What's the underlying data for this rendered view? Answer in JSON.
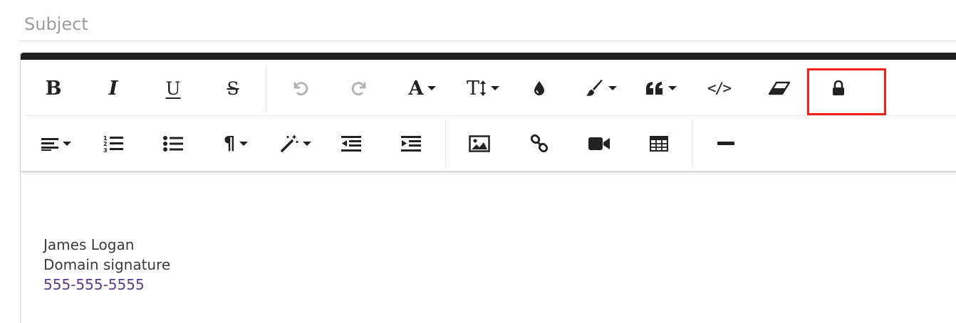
{
  "subject": {
    "placeholder": "Subject",
    "value": ""
  },
  "toolbar": {
    "row1": [
      {
        "name": "bold",
        "glyph": "B"
      },
      {
        "name": "italic",
        "glyph": "I"
      },
      {
        "name": "underline",
        "glyph": "U"
      },
      {
        "name": "strikethrough",
        "glyph": "S"
      },
      {
        "name": "undo",
        "icon": "undo-icon",
        "state": "disabled"
      },
      {
        "name": "redo",
        "icon": "redo-icon",
        "state": "disabled"
      },
      {
        "name": "font-color",
        "glyph": "A",
        "dropdown": true
      },
      {
        "name": "font-size",
        "glyph": "T",
        "dropdown": true
      },
      {
        "name": "fill-color",
        "icon": "droplet-icon"
      },
      {
        "name": "paint-format",
        "icon": "paint-brush-icon",
        "dropdown": true
      },
      {
        "name": "blockquote",
        "icon": "quote-icon",
        "dropdown": true
      },
      {
        "name": "code-view",
        "glyph": "</>"
      },
      {
        "name": "clear-formatting",
        "icon": "eraser-icon"
      },
      {
        "name": "lock",
        "icon": "lock-icon",
        "highlighted": true
      }
    ],
    "row2": [
      {
        "name": "align",
        "icon": "align-left-icon",
        "dropdown": true
      },
      {
        "name": "ordered-list",
        "icon": "ordered-list-icon"
      },
      {
        "name": "unordered-list",
        "icon": "unordered-list-icon"
      },
      {
        "name": "paragraph-format",
        "glyph": "¶",
        "dropdown": true
      },
      {
        "name": "styles",
        "icon": "magic-wand-icon",
        "dropdown": true
      },
      {
        "name": "outdent",
        "icon": "outdent-icon"
      },
      {
        "name": "indent",
        "icon": "indent-icon"
      },
      {
        "name": "insert-image",
        "icon": "image-icon"
      },
      {
        "name": "insert-link",
        "icon": "link-icon"
      },
      {
        "name": "insert-video",
        "icon": "video-icon"
      },
      {
        "name": "insert-table",
        "icon": "table-icon"
      },
      {
        "name": "horizontal-rule",
        "icon": "minus-icon"
      }
    ],
    "highlight_color": "#f2221b"
  },
  "glyphs": {
    "bold": "B",
    "italic": "I",
    "underline": "U",
    "strike": "S",
    "font_color": "A",
    "font_size": "T",
    "paragraph": "¶",
    "code": "</>"
  },
  "body": {
    "signature": {
      "name": "James Logan",
      "title": "Domain signature",
      "phone": "555-555-5555"
    }
  },
  "colors": {
    "toolbar_top": "#1f1f1f",
    "phone_link": "#5b3a8e"
  }
}
